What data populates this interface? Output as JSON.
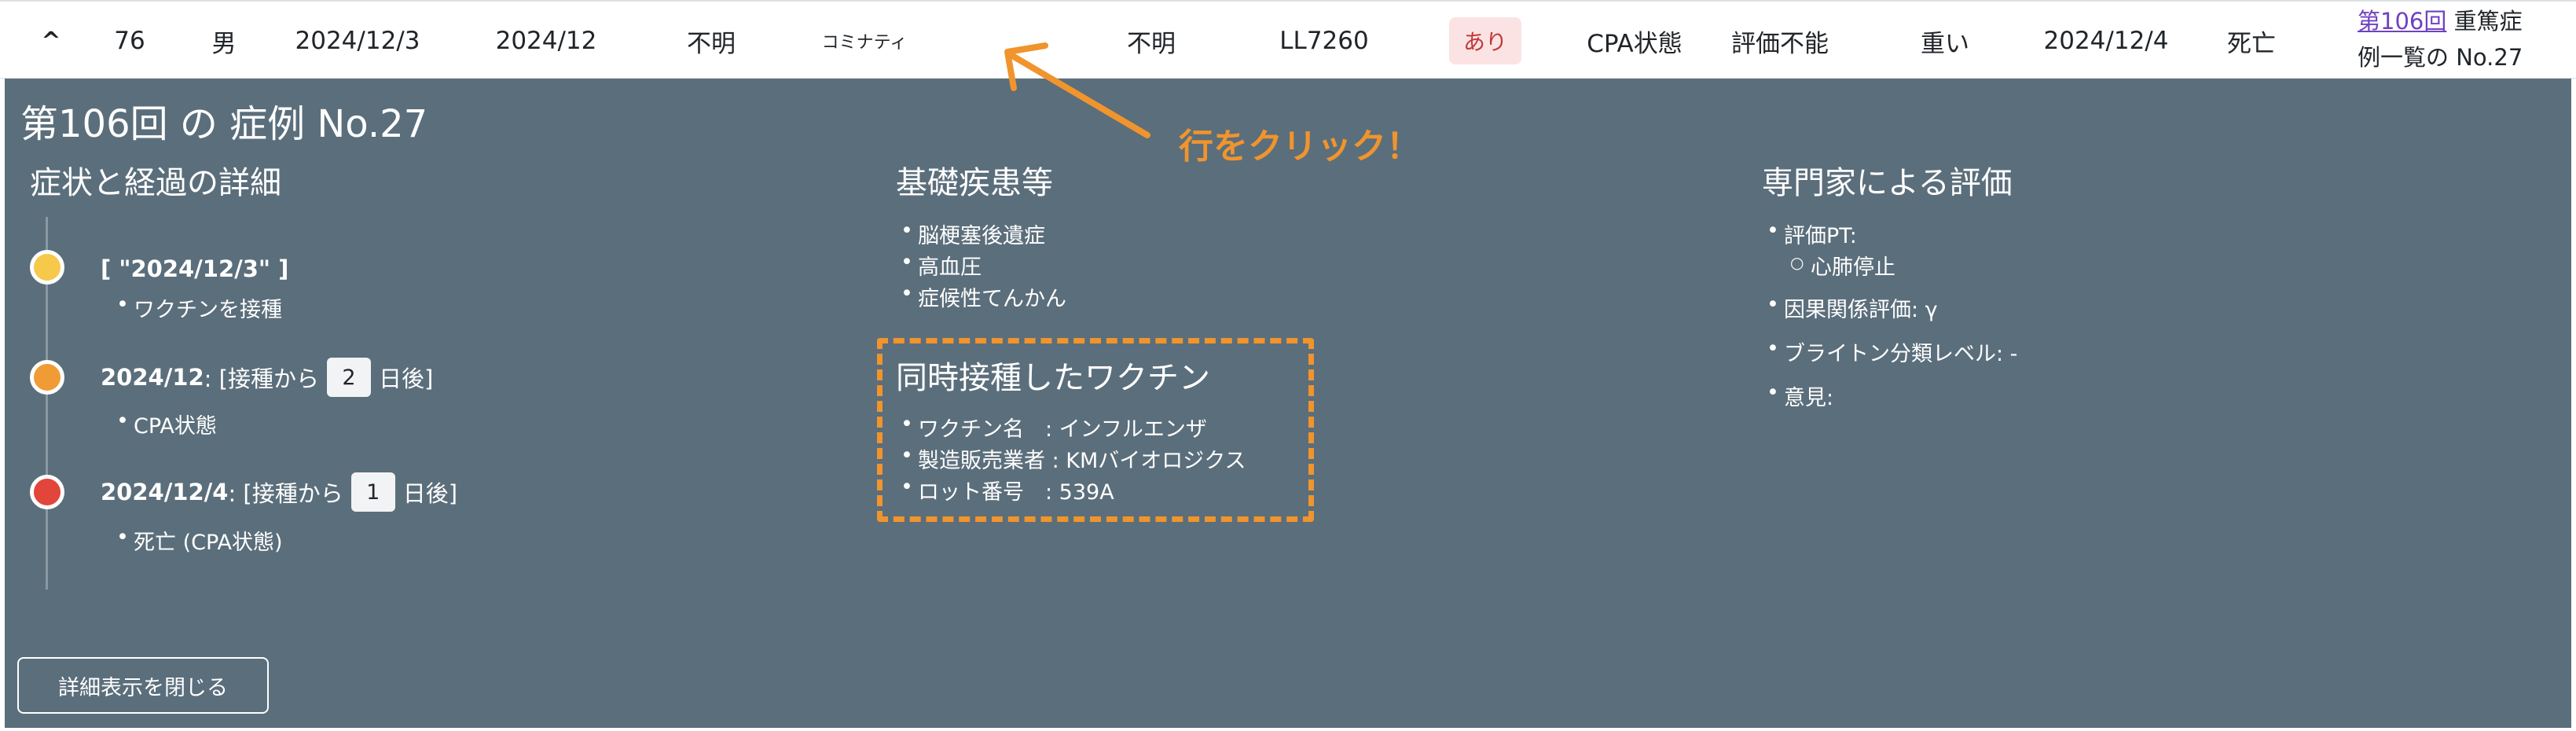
{
  "row": {
    "toggle": "^",
    "number": "76",
    "sex": "男",
    "vaccination_date": "2024/12/3",
    "onset_date": "2024/12",
    "age": "不明",
    "vaccine": "コミナティ",
    "manufacturer": "不明",
    "lot": "LL7260",
    "underlying": "あり",
    "symptom": "CPA状態",
    "causality": "評価不能",
    "severity": "重い",
    "report_date": "2024/12/4",
    "outcome": "死亡",
    "link_text": "第106回",
    "link_suffix_1": " 重篤症",
    "link_suffix_2": "例一覧の No.27"
  },
  "detail": {
    "title": "第106回 の 症例 No.27",
    "course": {
      "heading": "症状と経過の詳細",
      "events": [
        {
          "date": "[ \"2024/12/3\" ]",
          "note": "ワクチンを接種"
        },
        {
          "date": "2024/12",
          "prefix": ": [接種から",
          "days": "2",
          "suffix": "日後]",
          "note": "CPA状態"
        },
        {
          "date": "2024/12/4",
          "prefix": ": [接種から",
          "days": "1",
          "suffix": "日後]",
          "note": "死亡 (CPA状態)"
        }
      ]
    },
    "conditions": {
      "heading": "基礎疾患等",
      "items": [
        "脳梗塞後遺症",
        "高血圧",
        "症候性てんかん"
      ]
    },
    "concurrent_vaccine": {
      "heading": "同時接種したワクチン",
      "name": "ワクチン名　: インフルエンザ",
      "maker": "製造販売業者 : KMバイオロジクス",
      "lot": "ロット番号　: 539A"
    },
    "expert": {
      "heading": "専門家による評価",
      "pt_label": "評価PT:",
      "pt_value": "心肺停止",
      "causality": "因果関係評価: γ",
      "brighton": "ブライトン分類レベル: -",
      "opinion": "意見:"
    },
    "close_label": "詳細表示を閉じる"
  },
  "annotation": {
    "text": "行をクリック！",
    "color": "#f0942d"
  },
  "colors": {
    "panel_bg": "#5b6e7b",
    "badge_bg": "#fbe3e4",
    "badge_text": "#c23a3a",
    "link": "#6f42c1",
    "dot_yellow": "#f6c94a",
    "dot_orange": "#f09b35",
    "dot_red": "#e2453a"
  }
}
